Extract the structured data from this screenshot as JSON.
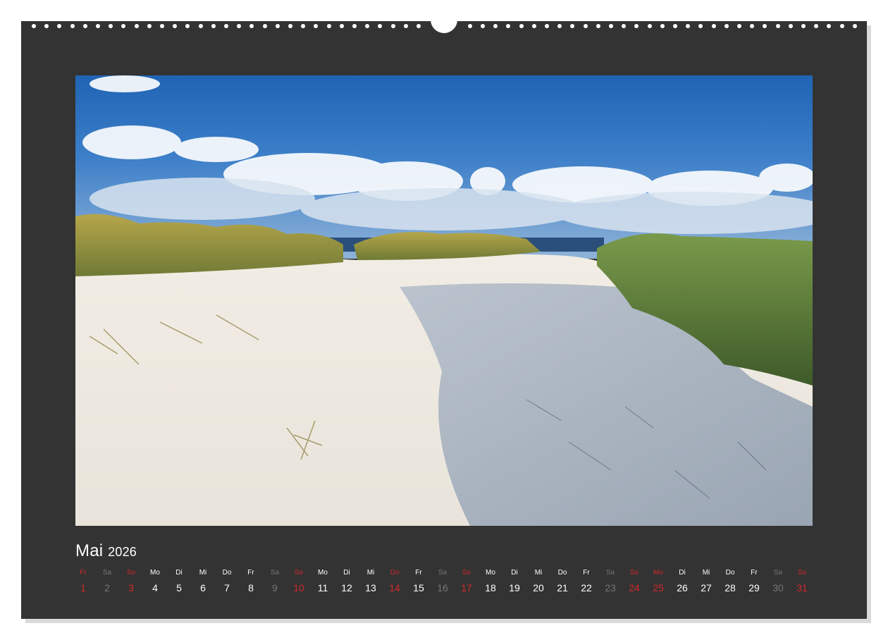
{
  "calendar": {
    "month": "Mai",
    "year": "2026",
    "days": [
      {
        "wd": "Fr",
        "d": "1",
        "kind": "red"
      },
      {
        "wd": "Sa",
        "d": "2",
        "kind": "sat"
      },
      {
        "wd": "So",
        "d": "3",
        "kind": "red"
      },
      {
        "wd": "Mo",
        "d": "4",
        "kind": "normal"
      },
      {
        "wd": "Di",
        "d": "5",
        "kind": "normal"
      },
      {
        "wd": "Mi",
        "d": "6",
        "kind": "normal"
      },
      {
        "wd": "Do",
        "d": "7",
        "kind": "normal"
      },
      {
        "wd": "Fr",
        "d": "8",
        "kind": "normal"
      },
      {
        "wd": "Sa",
        "d": "9",
        "kind": "sat"
      },
      {
        "wd": "So",
        "d": "10",
        "kind": "red"
      },
      {
        "wd": "Mo",
        "d": "11",
        "kind": "normal"
      },
      {
        "wd": "Di",
        "d": "12",
        "kind": "normal"
      },
      {
        "wd": "Mi",
        "d": "13",
        "kind": "normal"
      },
      {
        "wd": "Do",
        "d": "14",
        "kind": "red"
      },
      {
        "wd": "Fr",
        "d": "15",
        "kind": "normal"
      },
      {
        "wd": "Sa",
        "d": "16",
        "kind": "sat"
      },
      {
        "wd": "So",
        "d": "17",
        "kind": "red"
      },
      {
        "wd": "Mo",
        "d": "18",
        "kind": "normal"
      },
      {
        "wd": "Di",
        "d": "19",
        "kind": "normal"
      },
      {
        "wd": "Mi",
        "d": "20",
        "kind": "normal"
      },
      {
        "wd": "Do",
        "d": "21",
        "kind": "normal"
      },
      {
        "wd": "Fr",
        "d": "22",
        "kind": "normal"
      },
      {
        "wd": "Sa",
        "d": "23",
        "kind": "sat"
      },
      {
        "wd": "So",
        "d": "24",
        "kind": "red"
      },
      {
        "wd": "Mo",
        "d": "25",
        "kind": "red"
      },
      {
        "wd": "Di",
        "d": "26",
        "kind": "normal"
      },
      {
        "wd": "Mi",
        "d": "27",
        "kind": "normal"
      },
      {
        "wd": "Do",
        "d": "28",
        "kind": "normal"
      },
      {
        "wd": "Fr",
        "d": "29",
        "kind": "normal"
      },
      {
        "wd": "Sa",
        "d": "30",
        "kind": "sat"
      },
      {
        "wd": "So",
        "d": "31",
        "kind": "red"
      }
    ]
  },
  "colors": {
    "page_background": "#333333",
    "weekday_text": "#ffffff",
    "saturday_text": "#777777",
    "sunday_holiday_text": "#d1282b"
  },
  "photo": {
    "subject": "dune-path-image"
  }
}
